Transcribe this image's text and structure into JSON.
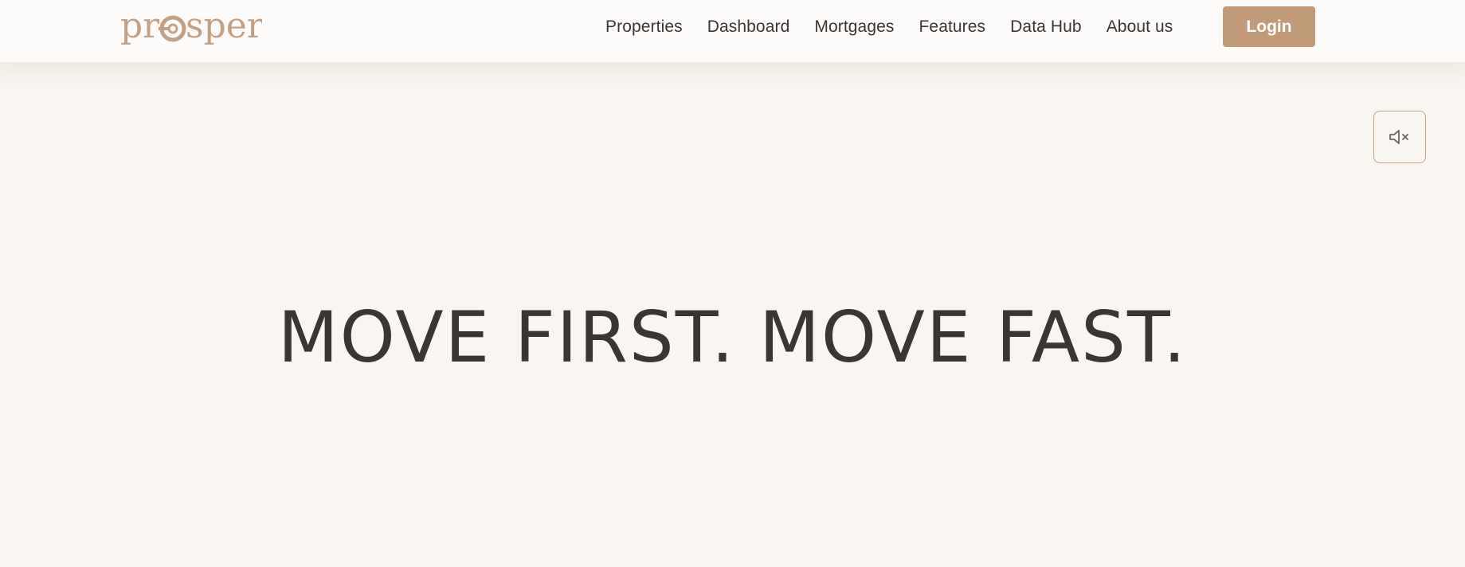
{
  "brand": {
    "name": "prosper",
    "color": "#c4a184"
  },
  "nav": {
    "items": [
      {
        "label": "Properties"
      },
      {
        "label": "Dashboard"
      },
      {
        "label": "Mortgages"
      },
      {
        "label": "Features"
      },
      {
        "label": "Data Hub"
      },
      {
        "label": "About us"
      }
    ],
    "login_label": "Login",
    "login_color": "#c19b77"
  },
  "media": {
    "mute_icon": "volume-muted-icon"
  },
  "hero": {
    "title": "MOVE FIRST. MOVE FAST."
  },
  "colors": {
    "background": "#f9f5f1",
    "header_background": "#fdfbfa",
    "text": "#3a3633",
    "accent": "#c19b77"
  }
}
